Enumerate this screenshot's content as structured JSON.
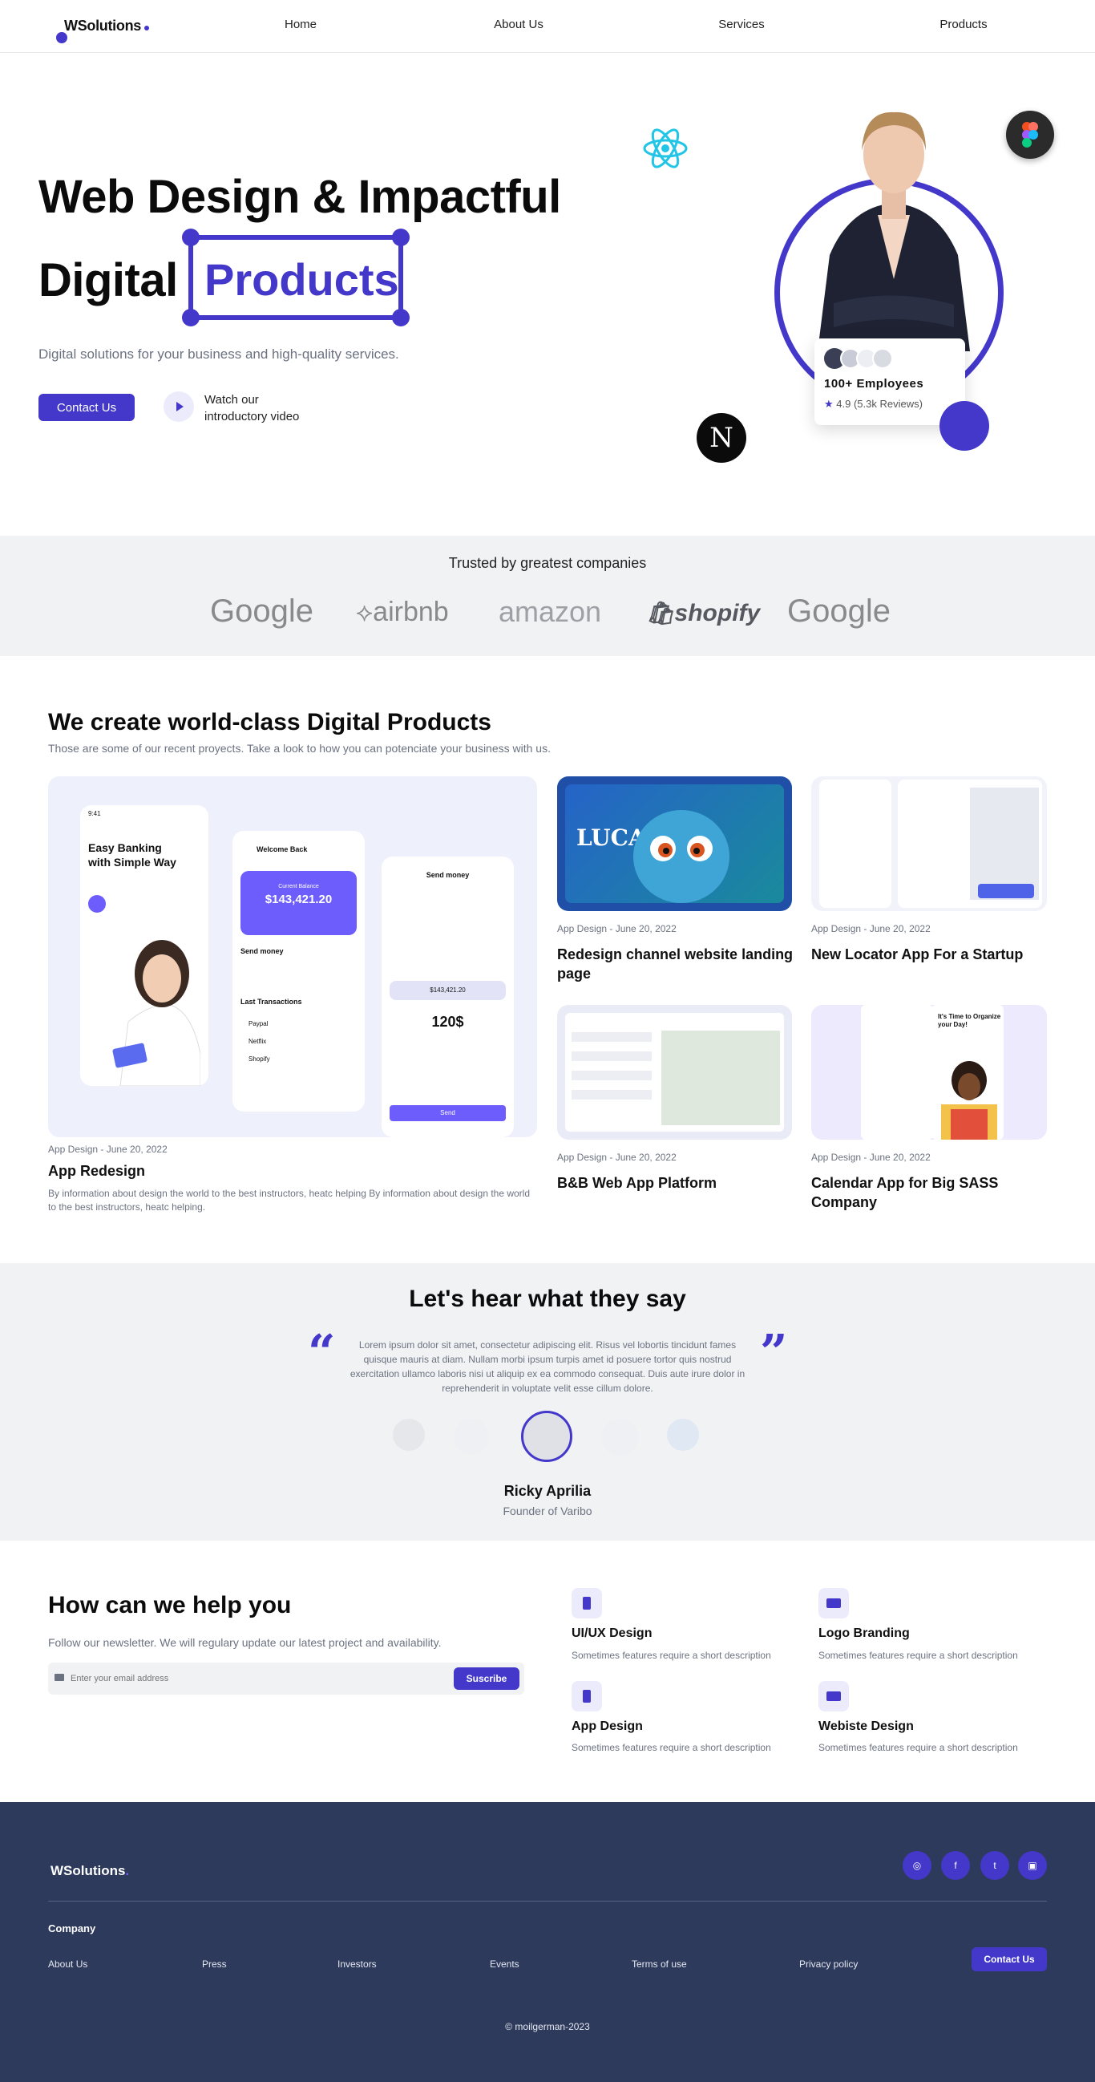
{
  "nav": {
    "logo": "WSolutions",
    "links": [
      "Home",
      "About Us",
      "Services",
      "Products"
    ]
  },
  "hero": {
    "title_line1": "Web Design & Impactful",
    "title_line2": "Digital",
    "title_highlight": "Products",
    "subtitle": "Digital solutions for your business and high-quality services.",
    "cta": "Contact Us",
    "video_label": "Watch our introductory video",
    "employees": "100+ Employees",
    "rating": "4.9 (5.3k Reviews)"
  },
  "trusted": {
    "title": "Trusted by greatest companies",
    "brands": [
      "Google",
      "airbnb",
      "amazon",
      "shopify",
      "Google"
    ]
  },
  "products": {
    "title": "We create world-class Digital Products",
    "subtitle": "Those are some of our recent proyects. Take a look to how you can potenciate your business with us.",
    "featured": {
      "meta": "App Design - June 20, 2022",
      "title": "App Redesign",
      "desc": "By information about design the world to the best instructors, heatc helping By information about design the world to the best instructors, heatc helping.",
      "mock": {
        "bank": "Easy Banking with Simple Way",
        "balance_label": "Current Balance",
        "balance": "$143,421.20",
        "send": "Send money",
        "amount": "120$",
        "send_btn": "Send",
        "welcome": "Welcome Back",
        "last_tx": "Last Transactions",
        "tx": [
          "Paypal",
          "Netflix",
          "Shopify"
        ],
        "time": "9:41"
      }
    },
    "items": [
      {
        "meta": "App Design - June 20, 2022",
        "title": "Redesign channel website landing page",
        "img_text": "LUCA"
      },
      {
        "meta": "App Design - June 20, 2022",
        "title": "New Locator App For a Startup",
        "img_text": ""
      },
      {
        "meta": "App Design - June 20, 2022",
        "title": "B&B Web App Platform",
        "img_text": ""
      },
      {
        "meta": "App Design - June 20, 2022",
        "title": "Calendar App for Big SASS Company",
        "img_text": "It's Time to Organize your Day!"
      }
    ]
  },
  "testimonials": {
    "title": "Let's hear what they say",
    "quote": "Lorem ipsum dolor sit amet, consectetur adipiscing elit. Risus vel lobortis tincidunt fames quisque mauris at diam. Nullam morbi ipsum turpis amet id posuere tortor quis nostrud exercitation ullamco laboris nisi ut aliquip ex ea commodo consequat. Duis aute irure dolor in reprehenderit in voluptate velit esse cillum dolore.",
    "name": "Ricky Aprilia",
    "role": "Founder of Varibo"
  },
  "help": {
    "title": "How can we help you",
    "subtitle": "Follow our newsletter. We will regulary update our latest project and availability.",
    "email_placeholder": "Enter your email address",
    "subscribe": "Suscribe",
    "services": [
      {
        "title": "UI/UX Design",
        "desc": "Sometimes features require a short description"
      },
      {
        "title": "Logo Branding",
        "desc": "Sometimes features require a short description"
      },
      {
        "title": "App Design",
        "desc": "Sometimes features require a short description"
      },
      {
        "title": "Webiste Design",
        "desc": "Sometimes features require a short description"
      }
    ]
  },
  "footer": {
    "logo": "WSolutions",
    "company": "Company",
    "links": [
      "About Us",
      "Press",
      "Investors",
      "Events",
      "Terms of use",
      "Privacy policy"
    ],
    "cta": "Contact Us",
    "social": [
      "instagram-icon",
      "facebook-icon",
      "twitter-icon",
      "twitch-icon"
    ],
    "copyright": "© moilgerman-2023"
  },
  "colors": {
    "accent": "#4338ca",
    "footer_bg": "#2d3a5c",
    "section_bg": "#f1f2f4"
  }
}
